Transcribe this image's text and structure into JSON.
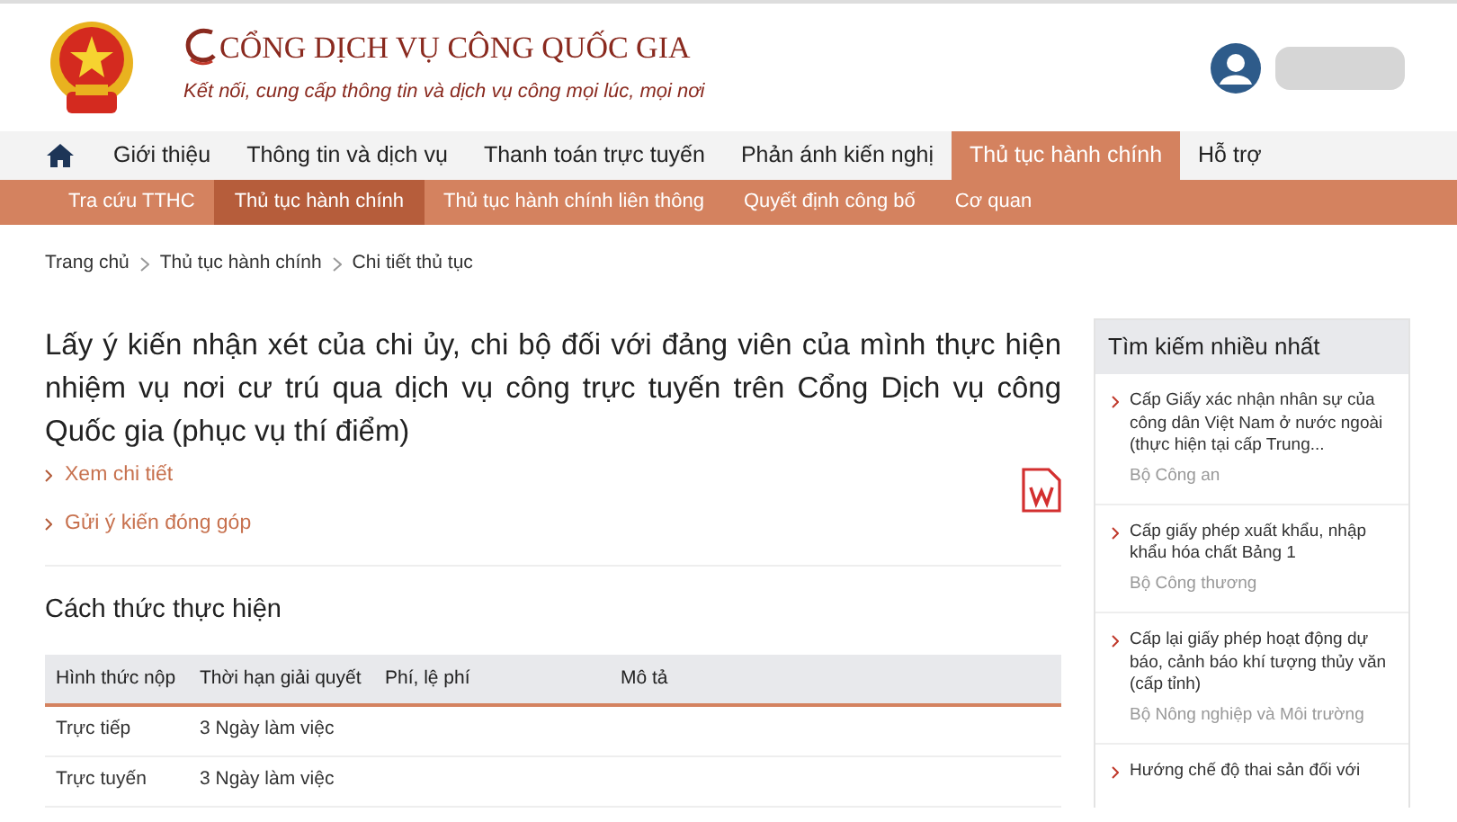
{
  "header": {
    "site_title": "CỔNG DỊCH VỤ CÔNG QUỐC GIA",
    "tagline": "Kết nối, cung cấp thông tin và dịch vụ công mọi lúc, mọi nơi"
  },
  "main_nav": [
    {
      "label": "Giới thiệu",
      "selected": false
    },
    {
      "label": "Thông tin và dịch vụ",
      "selected": false
    },
    {
      "label": "Thanh toán trực tuyến",
      "selected": false
    },
    {
      "label": "Phản ánh kiến nghị",
      "selected": false
    },
    {
      "label": "Thủ tục hành chính",
      "selected": true
    },
    {
      "label": "Hỗ trợ",
      "selected": false
    }
  ],
  "sub_nav": [
    {
      "label": "Tra cứu TTHC",
      "selected": false
    },
    {
      "label": "Thủ tục hành chính",
      "selected": true
    },
    {
      "label": "Thủ tục hành chính liên thông",
      "selected": false
    },
    {
      "label": "Quyết định công bố",
      "selected": false
    },
    {
      "label": "Cơ quan",
      "selected": false
    }
  ],
  "breadcrumb": [
    "Trang chủ",
    "Thủ tục hành chính",
    "Chi tiết thủ tục"
  ],
  "procedure": {
    "title": "Lấy ý kiến nhận xét của chi ủy, chi bộ đối với đảng viên của mình thực hiện nhiệm vụ nơi cư trú qua dịch vụ công trực tuyến trên Cổng Dịch vụ công Quốc gia (phục vụ thí điểm)",
    "links": [
      "Xem chi tiết",
      "Gửi ý kiến đóng góp"
    ]
  },
  "section_title": "Cách thức thực hiện",
  "table": {
    "columns": [
      "Hình thức nộp",
      "Thời hạn giải quyết",
      "Phí, lệ phí",
      "Mô tả"
    ],
    "rows": [
      [
        "Trực tiếp",
        "3 Ngày làm việc"
      ],
      [
        "Trực tuyến",
        "3 Ngày làm việc"
      ]
    ]
  },
  "sidebar": {
    "title": "Tìm kiếm nhiều nhất",
    "items": [
      {
        "title": "Cấp Giấy xác nhận nhân sự của công dân Việt Nam ở nước ngoài (thực hiện tại cấp Trung...",
        "agency": "Bộ Công an"
      },
      {
        "title": "Cấp giấy phép xuất khẩu, nhập khẩu hóa chất Bảng 1",
        "agency": "Bộ Công thương"
      },
      {
        "title": "Cấp lại giấy phép hoạt động dự báo, cảnh báo khí tượng thủy văn (cấp tỉnh)",
        "agency": "Bộ Nông nghiệp và Môi trường"
      },
      {
        "title": "Hướng chế độ thai sản đối với"
      }
    ]
  }
}
